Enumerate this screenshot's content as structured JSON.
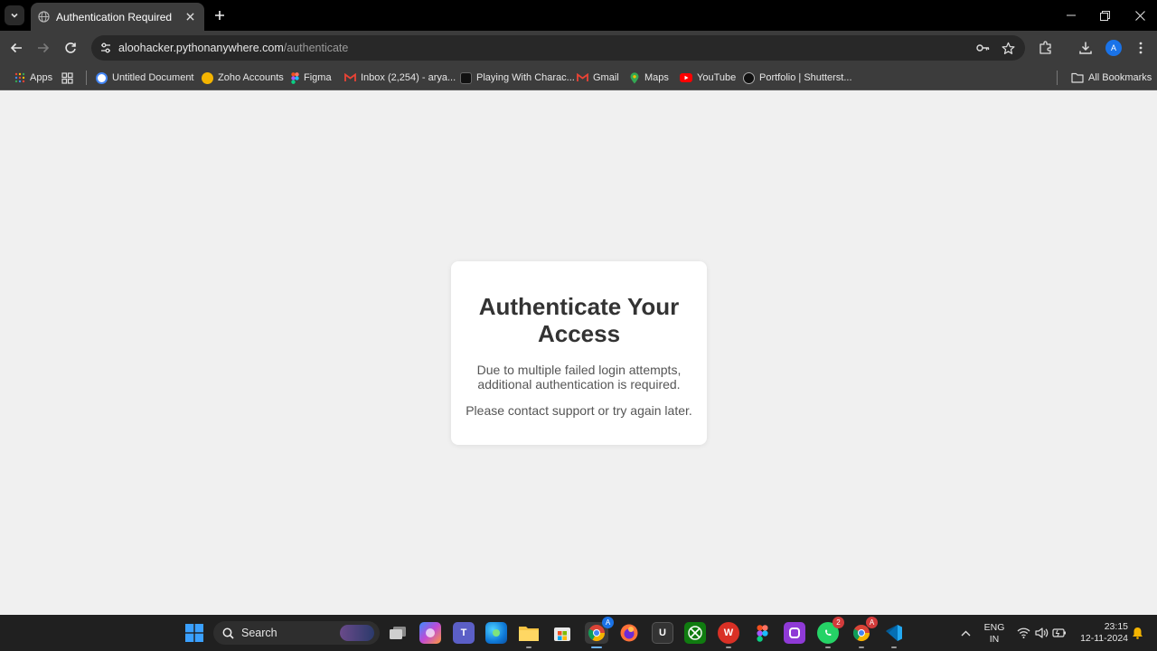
{
  "browser": {
    "tab": {
      "title": "Authentication Required"
    },
    "address_bar": {
      "host": "aloohacker.pythonanywhere.com",
      "path": "/authenticate"
    },
    "profile_initial": "A",
    "bookmarks": [
      {
        "label": "Apps",
        "icon": "apps-grid-icon"
      },
      {
        "label": "Untitled Document",
        "icon": "document-icon"
      },
      {
        "label": "Zoho Accounts",
        "icon": "zoho-icon"
      },
      {
        "label": "Figma",
        "icon": "figma-icon"
      },
      {
        "label": "Inbox (2,254) - arya...",
        "icon": "gmail-icon"
      },
      {
        "label": "Playing With Charac...",
        "icon": "site-icon"
      },
      {
        "label": "Gmail",
        "icon": "gmail-icon"
      },
      {
        "label": "Maps",
        "icon": "maps-icon"
      },
      {
        "label": "YouTube",
        "icon": "youtube-icon"
      },
      {
        "label": "Portfolio | Shutterst...",
        "icon": "shutterstock-icon"
      }
    ],
    "all_bookmarks": "All Bookmarks"
  },
  "page": {
    "heading": "Authenticate Your Access",
    "message_line1": "Due to multiple failed login attempts,",
    "message_line2": "additional authentication is required.",
    "message2": "Please contact support or try again later."
  },
  "taskbar": {
    "search_label": "Search",
    "language": "ENG",
    "region": "IN",
    "time": "23:15",
    "date": "12-11-2024",
    "badges": {
      "whatsapp": "2",
      "chrome2": "A",
      "chrome1": "A"
    }
  },
  "colors": {
    "page_bg": "#f0f0f0",
    "card_bg": "#ffffff",
    "heading": "#333333",
    "text": "#555555",
    "accent": "#1a73e8"
  }
}
